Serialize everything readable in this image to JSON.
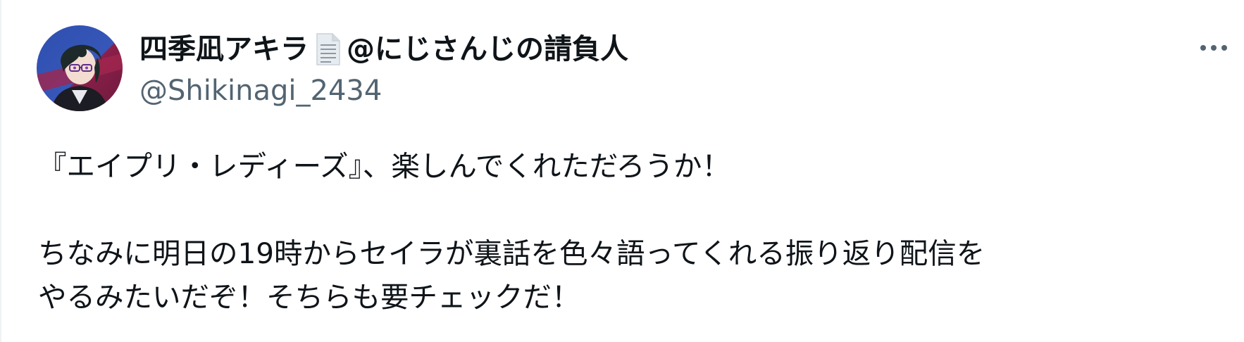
{
  "author": {
    "display_name_prefix": "四季凪アキラ",
    "display_name_suffix": "@にじさんじの請負人",
    "handle": "@Shikinagi_2434",
    "avatar_icon": "avatar-portrait",
    "name_emoji_icon": "page-facing-up-icon"
  },
  "toolbar": {
    "more_icon": "more-horizontal-icon"
  },
  "tweet": {
    "lines": [
      "『エイプリ・レディーズ』、楽しんでくれただろうか！",
      "",
      "ちなみに明日の19時からセイラが裏話を色々語ってくれる振り返り配信を",
      "やるみたいだぞ！そちらも要チェックだ！"
    ]
  },
  "colors": {
    "text_primary": "#0f1419",
    "text_secondary": "#536471",
    "border": "#eff3f4"
  }
}
